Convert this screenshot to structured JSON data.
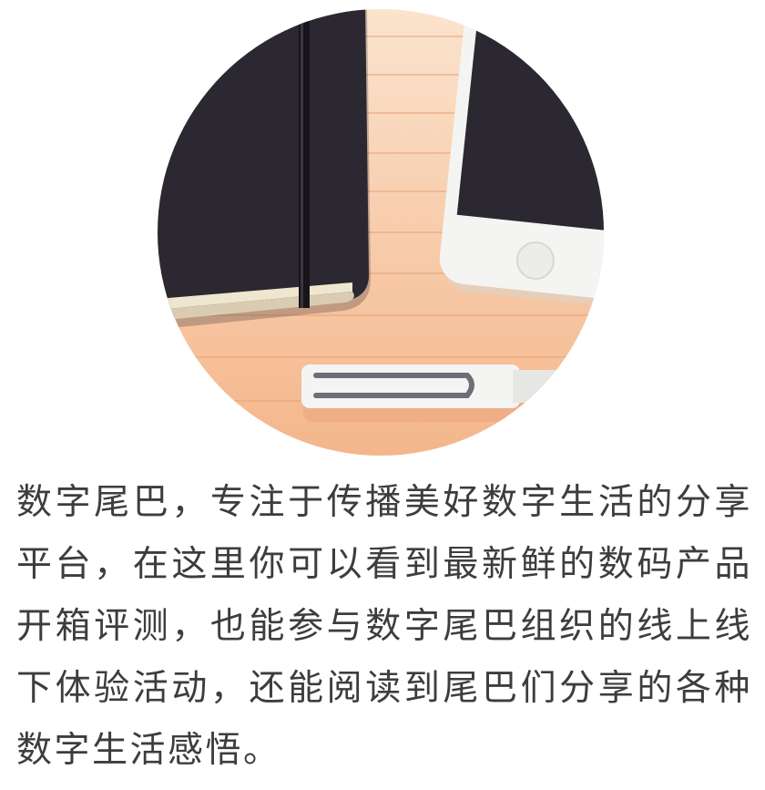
{
  "illustration": {
    "desk_color": "#f6c49c",
    "notebook_color": "#2b2831",
    "phone_color": "#f4f4f2",
    "pen_color": "#f2f2f2",
    "icons": [
      "desk-illustration",
      "notebook-icon",
      "smartphone-icon",
      "pen-icon"
    ]
  },
  "description": {
    "text": "数字尾巴，专注于传播美好数字生活的分享平台，在这里你可以看到最新鲜的数码产品开箱评测，也能参与数字尾巴组织的线上线下体验活动，还能阅读到尾巴们分享的各种数字生活感悟。"
  }
}
